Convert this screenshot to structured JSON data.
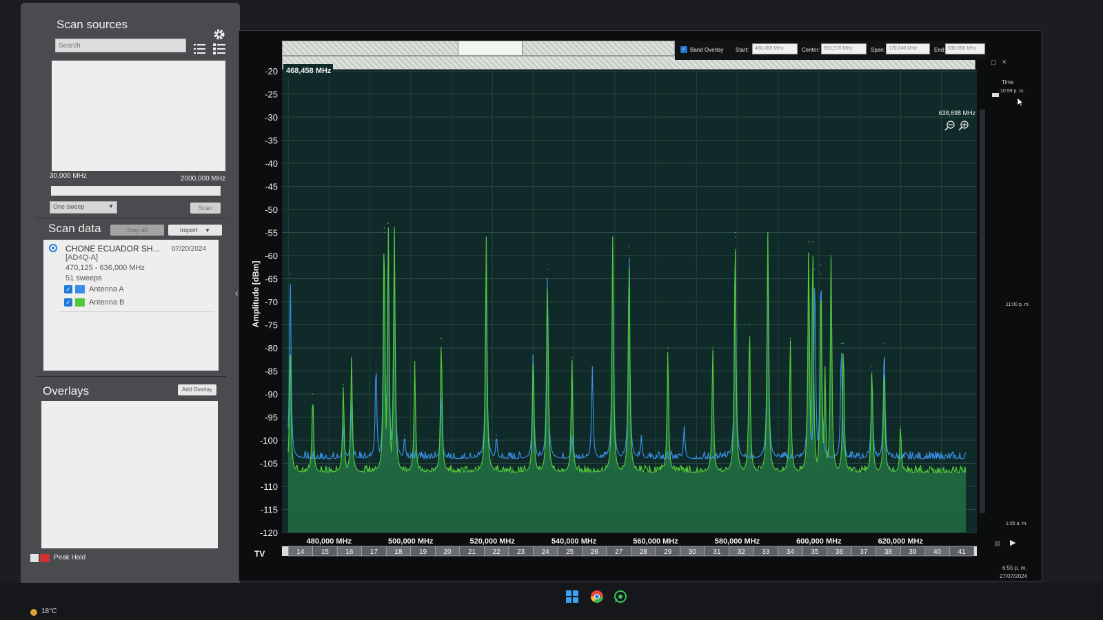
{
  "sources": {
    "title": "Scan sources",
    "search_placeholder": "Search",
    "range_min": "30,000 MHz",
    "range_max": "2000,000 MHz",
    "sweep_mode": "One sweep",
    "scan_label": "Scan"
  },
  "scan_data": {
    "title": "Scan data",
    "stop_all_label": "Stop all",
    "import_label": "Import",
    "items": [
      {
        "name": "CHONE ECUADOR SH...",
        "date": "07/20/2024",
        "device": "[AD4Q-A]",
        "freq_range": "470,125 - 636,000 MHz",
        "sweeps": "51 sweeps",
        "antennas": [
          {
            "label": "Antenna A",
            "color": "#3a8ee6",
            "checked": true
          },
          {
            "label": "Antenna B",
            "color": "#53c93a",
            "checked": true
          }
        ]
      }
    ]
  },
  "overlays": {
    "title": "Overlays",
    "add_label": "Add Overlay",
    "peak_hold_label": "Peak Hold"
  },
  "spectrum": {
    "band_overlay_label": "Band Overlay",
    "start_label": "Start:",
    "start_value": "468,458 MHz",
    "center_label": "Center:",
    "center_value": "553,578 MHz",
    "span_label": "Span:",
    "span_value": "170,240 MHz",
    "end_label": "End:",
    "end_value": "638,698 MHz",
    "start_marker": "468,458 MHz",
    "end_marker": "638,698 MHz",
    "time_label": "Time",
    "time_top": "10:59 p. m.",
    "time_mid": "11:00 p. m.",
    "time_bottom": "1:05 a. m.",
    "tv_label": "TV"
  },
  "chart_data": {
    "type": "line",
    "ylabel": "Amplitude [dBm]",
    "xlabel": "",
    "ylim": [
      -120,
      -20
    ],
    "xlim": [
      468.458,
      638.698
    ],
    "y_ticks": [
      -20,
      -25,
      -30,
      -35,
      -40,
      -45,
      -50,
      -55,
      -60,
      -65,
      -70,
      -75,
      -80,
      -85,
      -90,
      -95,
      -100,
      -105,
      -110,
      -115,
      -120
    ],
    "x_tick_labels": [
      "480,000 MHz",
      "500,000 MHz",
      "520,000 MHz",
      "540,000 MHz",
      "560,000 MHz",
      "580,000 MHz",
      "600,000 MHz",
      "620,000 MHz"
    ],
    "x_ticks": [
      480,
      500,
      520,
      540,
      560,
      580,
      600,
      620
    ],
    "noise_floor": {
      "Antenna A": -104,
      "Antenna B": -107
    },
    "series": [
      {
        "name": "Antenna A",
        "color": "#3a8ee6",
        "peaks": [
          [
            470.5,
            -64
          ],
          [
            483.5,
            -97
          ],
          [
            485.5,
            -92
          ],
          [
            491.5,
            -83
          ],
          [
            493.5,
            -55
          ],
          [
            494.5,
            -54
          ],
          [
            496.0,
            -56
          ],
          [
            498.5,
            -99
          ],
          [
            507.5,
            -90
          ],
          [
            518.5,
            -60
          ],
          [
            521.0,
            -99
          ],
          [
            530.0,
            -80
          ],
          [
            533.5,
            -63
          ],
          [
            539.5,
            -99
          ],
          [
            544.5,
            -84
          ],
          [
            549.5,
            -58
          ],
          [
            553.5,
            -58
          ],
          [
            556.5,
            -99
          ],
          [
            567.0,
            -97
          ],
          [
            579.5,
            -56
          ],
          [
            587.5,
            -56
          ],
          [
            597.5,
            -61
          ],
          [
            599.0,
            -63
          ],
          [
            600.5,
            -62
          ],
          [
            601.0,
            -95
          ],
          [
            605.5,
            -79
          ],
          [
            613.0,
            -85
          ],
          [
            616.0,
            -79
          ]
        ]
      },
      {
        "name": "Antenna B",
        "color": "#53c93a",
        "peaks": [
          [
            470.5,
            -80
          ],
          [
            476.0,
            -90
          ],
          [
            483.5,
            -88
          ],
          [
            485.5,
            -82
          ],
          [
            493.5,
            -54
          ],
          [
            494.5,
            -53
          ],
          [
            496.0,
            -54
          ],
          [
            501.0,
            -83
          ],
          [
            507.5,
            -78
          ],
          [
            518.5,
            -56
          ],
          [
            530.0,
            -82
          ],
          [
            533.5,
            -65
          ],
          [
            539.5,
            -82
          ],
          [
            549.5,
            -56
          ],
          [
            553.5,
            -60
          ],
          [
            563.0,
            -80
          ],
          [
            574.0,
            -80
          ],
          [
            579.5,
            -55
          ],
          [
            583.0,
            -75
          ],
          [
            587.5,
            -55
          ],
          [
            593.0,
            -78
          ],
          [
            597.5,
            -57
          ],
          [
            598.5,
            -57
          ],
          [
            600.5,
            -64
          ],
          [
            601.5,
            -84
          ],
          [
            603.0,
            -60
          ],
          [
            606.0,
            -79
          ],
          [
            613.0,
            -84
          ],
          [
            616.0,
            -83
          ],
          [
            620.0,
            -97
          ]
        ]
      }
    ],
    "tv_channels": [
      "14",
      "15",
      "16",
      "17",
      "18",
      "19",
      "20",
      "21",
      "22",
      "23",
      "24",
      "25",
      "26",
      "27",
      "28",
      "29",
      "30",
      "31",
      "32",
      "33",
      "34",
      "35",
      "36",
      "37",
      "38",
      "39",
      "40",
      "41"
    ]
  },
  "taskbar": {
    "weather": "18°C",
    "clock_time": "6:55 p. m.",
    "clock_date": "27/07/2024"
  }
}
